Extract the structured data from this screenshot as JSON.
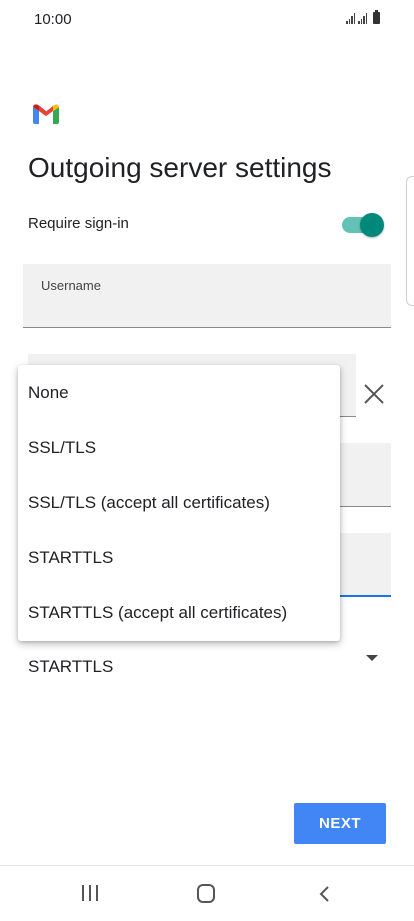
{
  "status_bar": {
    "time": "10:00",
    "icons": [
      "signal-icon",
      "signal-icon",
      "battery-icon"
    ]
  },
  "app": {
    "logo": "gmail-logo-icon",
    "brand_colors": [
      "#ea4335",
      "#4285f4",
      "#34a853",
      "#fbbc04",
      "#c5221f"
    ]
  },
  "page": {
    "title": "Outgoing server settings"
  },
  "require_signin": {
    "label": "Require sign-in",
    "enabled": true,
    "accent": "#00897b"
  },
  "fields": {
    "username_label": "Username"
  },
  "security": {
    "selected": "STARTTLS",
    "options": [
      "None",
      "SSL/TLS",
      "SSL/TLS (accept all certificates)",
      "STARTTLS",
      "STARTTLS (accept all certificates)"
    ]
  },
  "footer": {
    "next_label": "NEXT",
    "next_color": "#4285f4"
  },
  "nav_bar": {
    "icons": [
      "recent-apps-icon",
      "home-icon",
      "back-icon"
    ]
  }
}
